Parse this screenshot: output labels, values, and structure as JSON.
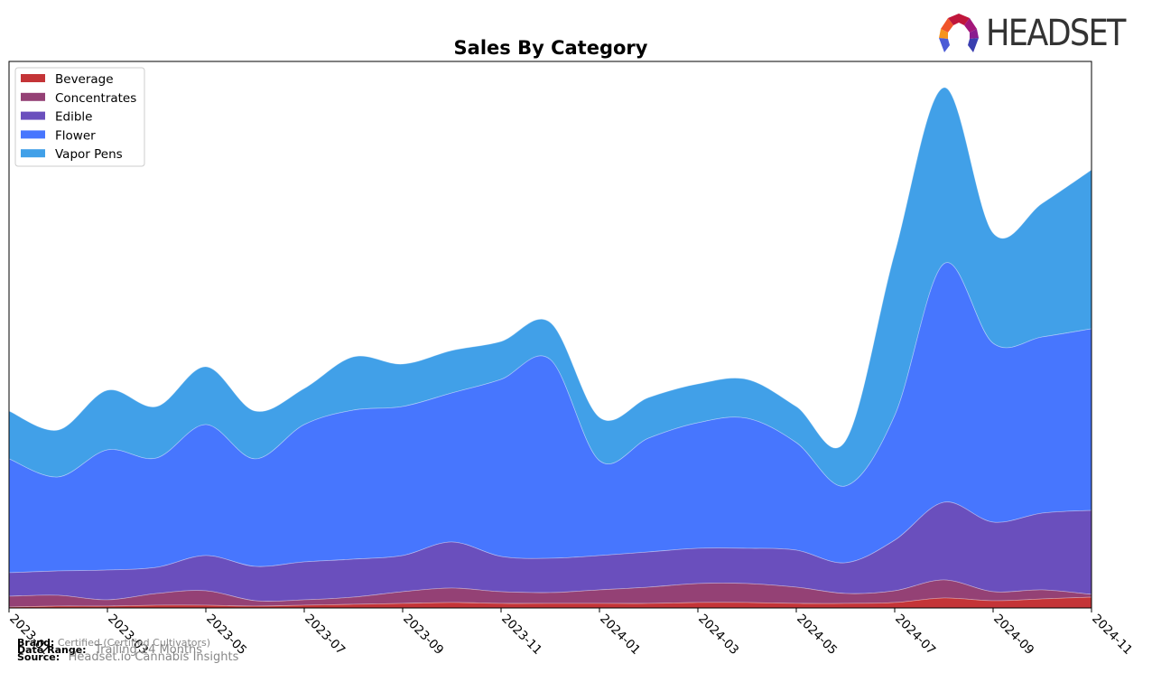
{
  "chart_data": {
    "type": "area",
    "stacked": true,
    "title": "Sales By Category",
    "xlabel": "",
    "ylabel": "",
    "y_units": "relative (no y-axis scale shown)",
    "ylim": [
      0,
      605
    ],
    "x": [
      "2023-01",
      "2023-02",
      "2023-03",
      "2023-04",
      "2023-05",
      "2023-06",
      "2023-07",
      "2023-08",
      "2023-09",
      "2023-10",
      "2023-11",
      "2023-12",
      "2024-01",
      "2024-02",
      "2024-03",
      "2024-04",
      "2024-05",
      "2024-06",
      "2024-07",
      "2024-08",
      "2024-09",
      "2024-10",
      "2024-11"
    ],
    "x_tick_labels": [
      "2023-01",
      "2023-03",
      "2023-05",
      "2023-07",
      "2023-09",
      "2023-11",
      "2024-01",
      "2024-03",
      "2024-05",
      "2024-07",
      "2024-09",
      "2024-11"
    ],
    "grid": false,
    "legend_position": "top-left",
    "series": [
      {
        "name": "Beverage",
        "color": "#c43437",
        "values": [
          1,
          2,
          2,
          3,
          3,
          2,
          3,
          4,
          5,
          6,
          5,
          5,
          5,
          5,
          6,
          6,
          5,
          5,
          6,
          11,
          8,
          10,
          12
        ]
      },
      {
        "name": "Concentrates",
        "color": "#944175",
        "values": [
          12,
          12,
          7,
          13,
          16,
          6,
          6,
          8,
          13,
          16,
          13,
          12,
          15,
          18,
          21,
          21,
          18,
          11,
          13,
          20,
          10,
          10,
          3
        ]
      },
      {
        "name": "Edible",
        "color": "#6a4fbd",
        "values": [
          26,
          27,
          33,
          29,
          39,
          38,
          42,
          42,
          40,
          51,
          39,
          38,
          38,
          39,
          39,
          39,
          41,
          34,
          56,
          86,
          77,
          85,
          93
        ]
      },
      {
        "name": "Flower",
        "color": "#4776fe",
        "values": [
          126,
          104,
          133,
          121,
          145,
          119,
          152,
          165,
          165,
          165,
          196,
          220,
          105,
          126,
          139,
          144,
          119,
          85,
          138,
          264,
          198,
          195,
          201
        ]
      },
      {
        "name": "Vapor Pens",
        "color": "#41a0e8",
        "values": [
          53,
          52,
          66,
          57,
          64,
          53,
          40,
          59,
          47,
          47,
          42,
          41,
          48,
          45,
          43,
          43,
          40,
          50,
          180,
          195,
          122,
          148,
          176
        ]
      }
    ]
  },
  "footer": {
    "brand_label": "Brand:",
    "brand_value": "Certified (Certified Cultivators)",
    "date_range_label": "Date Range:",
    "date_range_value": "Trailing 24 Months",
    "source_label": "Source:",
    "source_value": "Headset.io Cannabis Insights"
  },
  "logo": {
    "text": "HEADSET"
  }
}
